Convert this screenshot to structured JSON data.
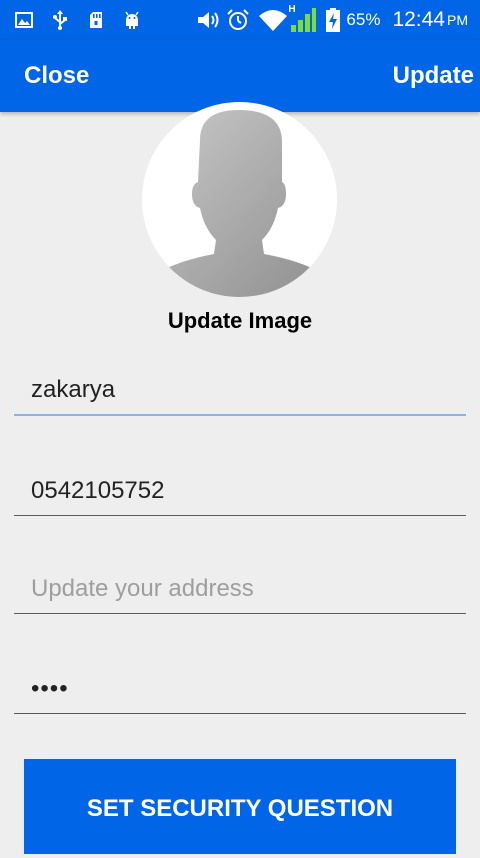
{
  "status_bar": {
    "left_icons": [
      "image-icon",
      "usb-icon",
      "sd-card-icon",
      "android-icon"
    ],
    "right_icons": [
      "volume-icon",
      "alarm-icon",
      "wifi-icon",
      "cell-signal-icon",
      "battery-charging-icon"
    ],
    "network_type": "H",
    "battery_percent": "65%",
    "time": "12:44",
    "ampm": "PM"
  },
  "toolbar": {
    "close_label": "Close",
    "update_label": "Update"
  },
  "profile": {
    "update_image_label": "Update Image"
  },
  "form": {
    "name_value": "zakarya",
    "phone_value": "0542105752",
    "address_value": "",
    "address_placeholder": "Update your address",
    "password_value": "••••"
  },
  "security_button_label": "SET SECURITY QUESTION",
  "colors": {
    "primary": "#0065e6",
    "background": "#eeeeee",
    "focus_underline": "#8fb0e6"
  }
}
